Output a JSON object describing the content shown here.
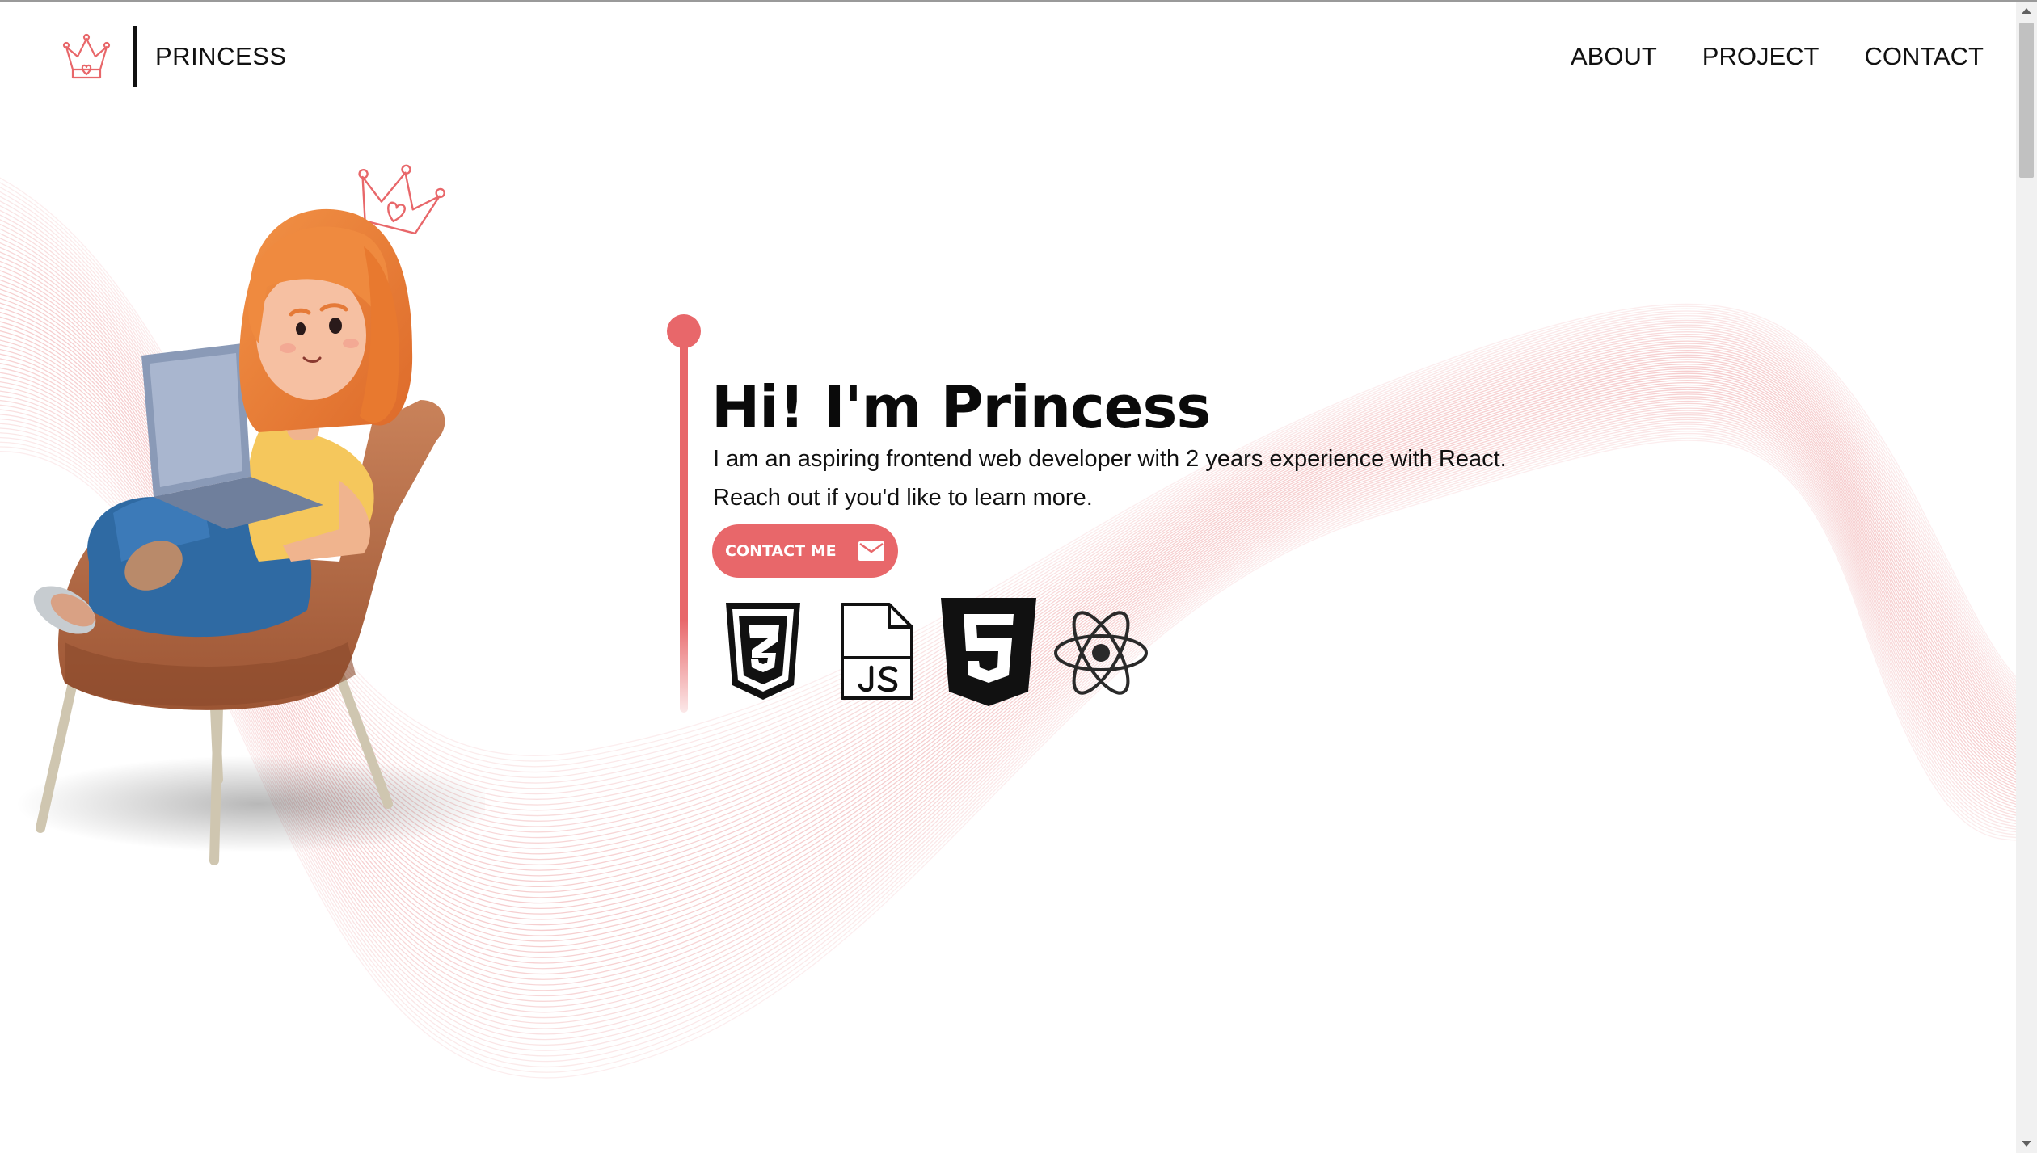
{
  "header": {
    "logo_icon": "crown-heart-icon",
    "brand": "PRINCESS",
    "nav": [
      "ABOUT",
      "PROJECT",
      "CONTACT"
    ]
  },
  "hero": {
    "title": "Hi! I'm Princess",
    "line1": "I am an aspiring frontend web developer with 2 years experience with React.",
    "line2": "Reach out if you'd like to learn more.",
    "cta_label": "CONTACT ME",
    "cta_icon": "mail-icon",
    "illustration": "girl-on-armchair-with-laptop-illustration",
    "tech_icons": [
      "css3-icon",
      "javascript-file-icon",
      "html5-icon",
      "react-atom-icon"
    ]
  },
  "colors": {
    "accent": "#e8676a",
    "wave": "#f2b9ba",
    "text": "#111111",
    "background": "#ffffff"
  }
}
